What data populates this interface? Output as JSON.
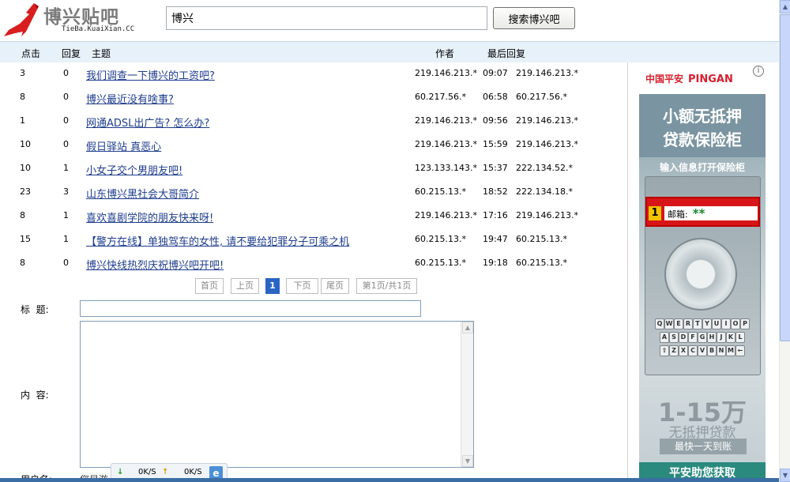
{
  "header": {
    "logo_title": "博兴贴吧",
    "logo_subtitle": "TieBa.KuaiXian.CC",
    "search_value": "博兴",
    "search_button": "搜索博兴吧"
  },
  "columns": {
    "clicks": "点击",
    "replies": "回复",
    "topic": "主题",
    "author": "作者",
    "last_reply": "最后回复"
  },
  "threads": [
    {
      "clicks": "3",
      "replies": "0",
      "title": "我们调查一下博兴的工资吧?",
      "author": "219.146.213.*",
      "time": "09:07",
      "last": "219.146.213.*"
    },
    {
      "clicks": "8",
      "replies": "0",
      "title": "博兴最近没有啥事?",
      "author": "60.217.56.*",
      "time": "06:58",
      "last": "60.217.56.*"
    },
    {
      "clicks": "1",
      "replies": "0",
      "title": "网通ADSL出广告? 怎么办?",
      "author": "219.146.213.*",
      "time": "09:56",
      "last": "219.146.213.*"
    },
    {
      "clicks": "10",
      "replies": "0",
      "title": "假日驿站 真恶心",
      "author": "219.146.213.*",
      "time": "15:59",
      "last": "219.146.213.*"
    },
    {
      "clicks": "10",
      "replies": "1",
      "title": "小女子交个男朋友吧!",
      "author": "123.133.143.*",
      "time": "15:37",
      "last": "222.134.52.*"
    },
    {
      "clicks": "23",
      "replies": "3",
      "title": "山东博兴黑社会大哥简介",
      "author": "60.215.13.*",
      "time": "18:52",
      "last": "222.134.18.*"
    },
    {
      "clicks": "8",
      "replies": "1",
      "title": "喜欢喜剧学院的朋友快来呀!",
      "author": "219.146.213.*",
      "time": "17:16",
      "last": "219.146.213.*"
    },
    {
      "clicks": "15",
      "replies": "1",
      "title": "【警方在线】单独驾车的女性, 请不要给犯罪分子可乘之机",
      "author": "60.215.13.*",
      "time": "19:47",
      "last": "60.215.13.*"
    },
    {
      "clicks": "8",
      "replies": "0",
      "title": "博兴快线热烈庆祝博兴吧开吧!",
      "author": "60.215.13.*",
      "time": "19:18",
      "last": "60.215.13.*"
    }
  ],
  "pager": {
    "first": "首页",
    "prev": "上页",
    "current": "1",
    "next": "下页",
    "last": "尾页",
    "info": "第1页/共1页"
  },
  "form": {
    "title_label": "标  题:",
    "content_label": "内  容:",
    "username_label": "用户名:",
    "username_value": "您是游"
  },
  "net_widget": {
    "down": "0K/S",
    "up": "0K/S"
  },
  "ad": {
    "brand_cn": "中国平安",
    "brand_en": "PINGAN",
    "info_mark": "i",
    "head_line1": "小额无抵押",
    "head_line2": "贷款保险柜",
    "sub": "输入信息打开保险柜",
    "step_num": "1",
    "email_label": "邮箱:",
    "email_value": "**",
    "keys_row1": [
      "Q",
      "W",
      "E",
      "R",
      "T",
      "Y",
      "U",
      "I",
      "O",
      "P"
    ],
    "keys_row2": [
      "A",
      "S",
      "D",
      "F",
      "G",
      "H",
      "J",
      "K",
      "L"
    ],
    "keys_row3": [
      "⇧",
      "Z",
      "X",
      "C",
      "V",
      "B",
      "N",
      "M",
      "←"
    ],
    "big": "1-15万",
    "big_sub": "无抵押贷款",
    "button": "最快一天到账",
    "footer": "平安助您获取"
  },
  "colors": {
    "link": "#1d3c8d",
    "header_bar": "#e7f1fa",
    "brand_red": "#d6202d",
    "pager_current": "#2b65c4"
  }
}
